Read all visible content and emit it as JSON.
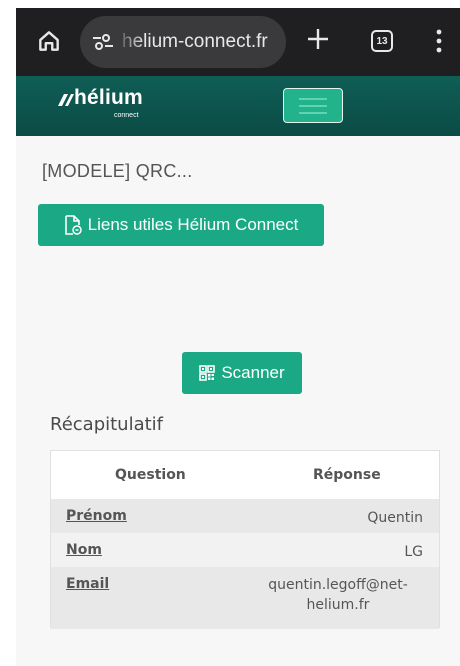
{
  "browser": {
    "url": "helium-connect.fr",
    "tab_count": "13"
  },
  "header": {
    "logo_word": "hélium",
    "logo_sub": "connect",
    "brand_color": "#0d5a52",
    "accent_color": "#1aa984"
  },
  "page": {
    "title": "[MODELE] QRC...",
    "links_button": "Liens utiles Hélium Connect",
    "scan_button": "Scanner",
    "section_title": "Récapitulatif"
  },
  "table": {
    "headers": [
      "Question",
      "Réponse"
    ],
    "rows": [
      {
        "question": "Prénom",
        "answer": "Quentin"
      },
      {
        "question": "Nom",
        "answer": "LG"
      },
      {
        "question": "Email",
        "answer": "quentin.legoff@net-helium.fr"
      }
    ]
  },
  "icons": {
    "home": "home-icon",
    "site_settings": "tune-icon",
    "new_tab": "plus-icon",
    "tabs": "tabs-icon",
    "more": "more-vert-icon",
    "links": "document-link-icon",
    "scanner": "qr-code-icon",
    "menu": "hamburger-icon"
  }
}
